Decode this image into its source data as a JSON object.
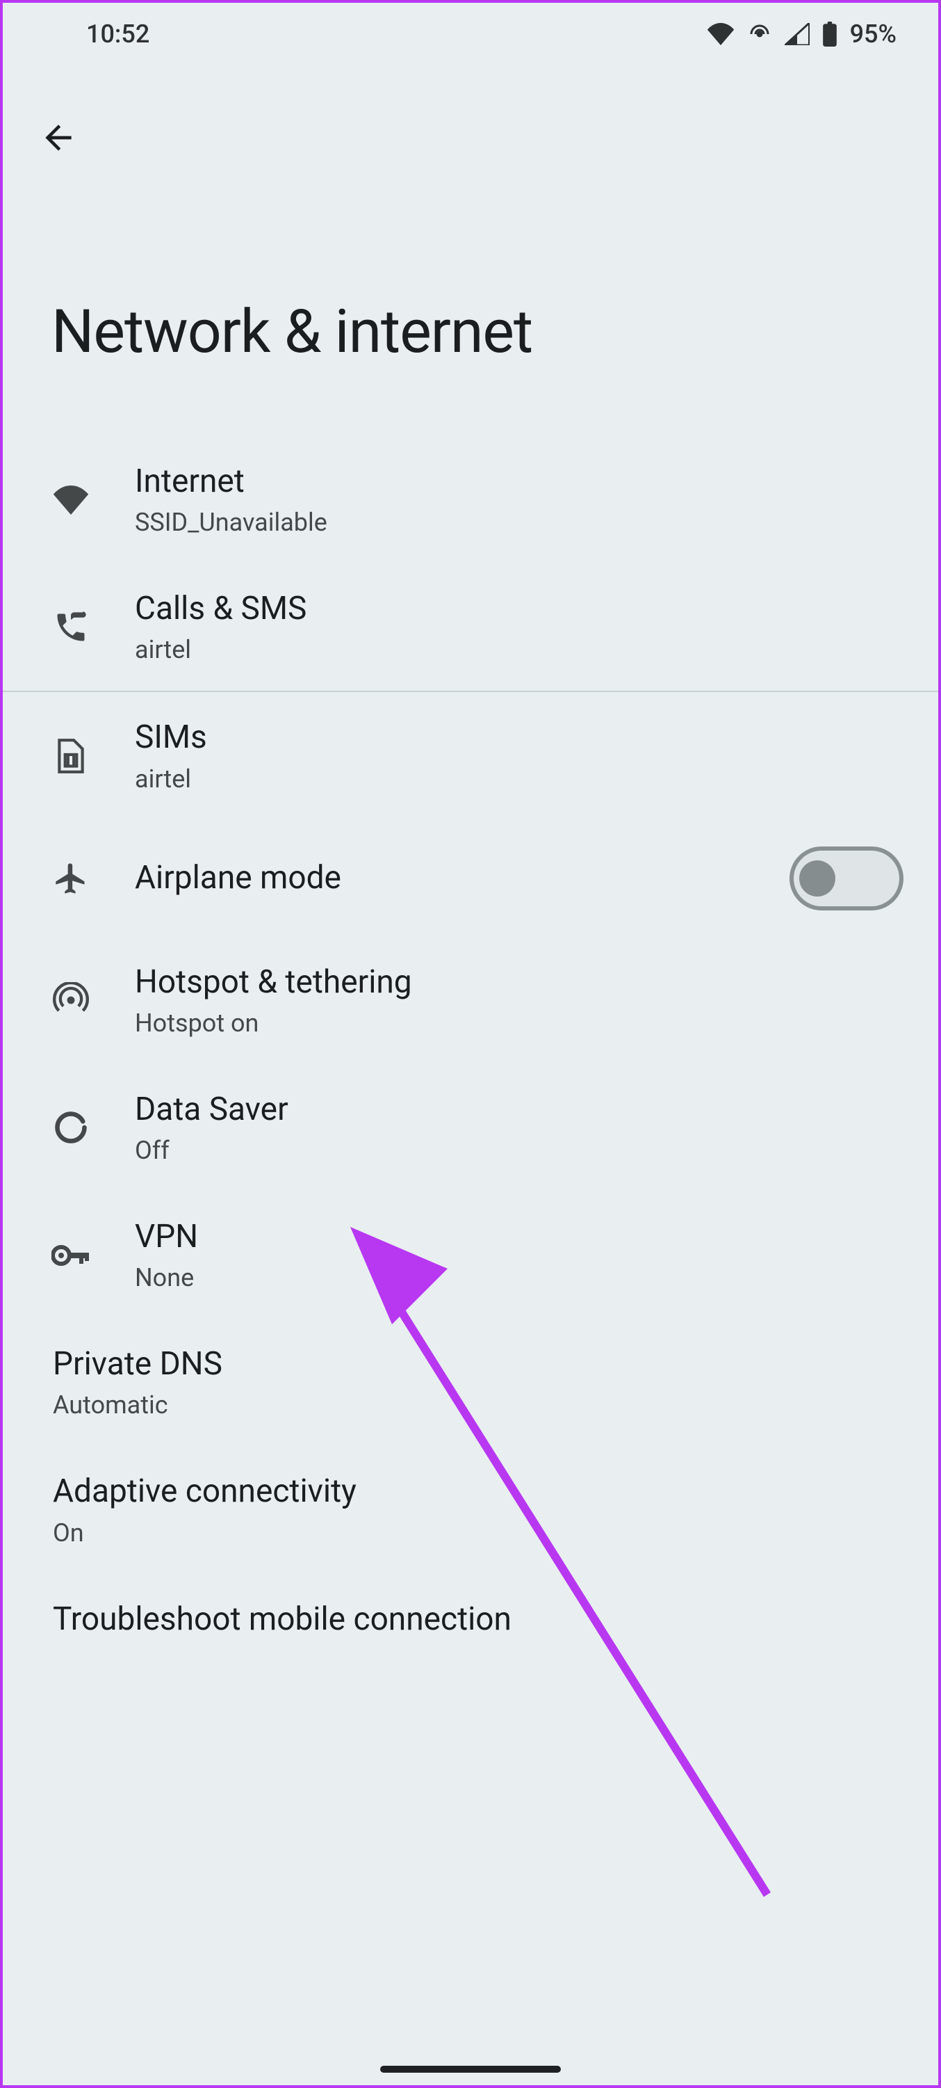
{
  "status": {
    "time": "10:52",
    "battery_pct": "95%"
  },
  "page": {
    "title": "Network & internet"
  },
  "items": [
    {
      "title": "Internet",
      "sub": "SSID_Unavailable"
    },
    {
      "title": "Calls & SMS",
      "sub": "airtel"
    },
    {
      "title": "SIMs",
      "sub": "airtel"
    },
    {
      "title": "Airplane mode",
      "sub": ""
    },
    {
      "title": "Hotspot & tethering",
      "sub": "Hotspot on"
    },
    {
      "title": "Data Saver",
      "sub": "Off"
    },
    {
      "title": "VPN",
      "sub": "None"
    },
    {
      "title": "Private DNS",
      "sub": "Automatic"
    },
    {
      "title": "Adaptive connectivity",
      "sub": "On"
    },
    {
      "title": "Troubleshoot mobile connection",
      "sub": ""
    }
  ],
  "airplane_mode_on": false
}
